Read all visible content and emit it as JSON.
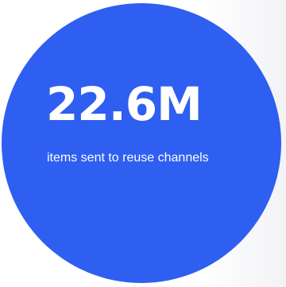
{
  "stat": {
    "value": "22.6M",
    "caption": "items sent to reuse channels"
  },
  "colors": {
    "circle": "#2e5ff0",
    "text": "#ffffff",
    "background": "#ffffff"
  }
}
